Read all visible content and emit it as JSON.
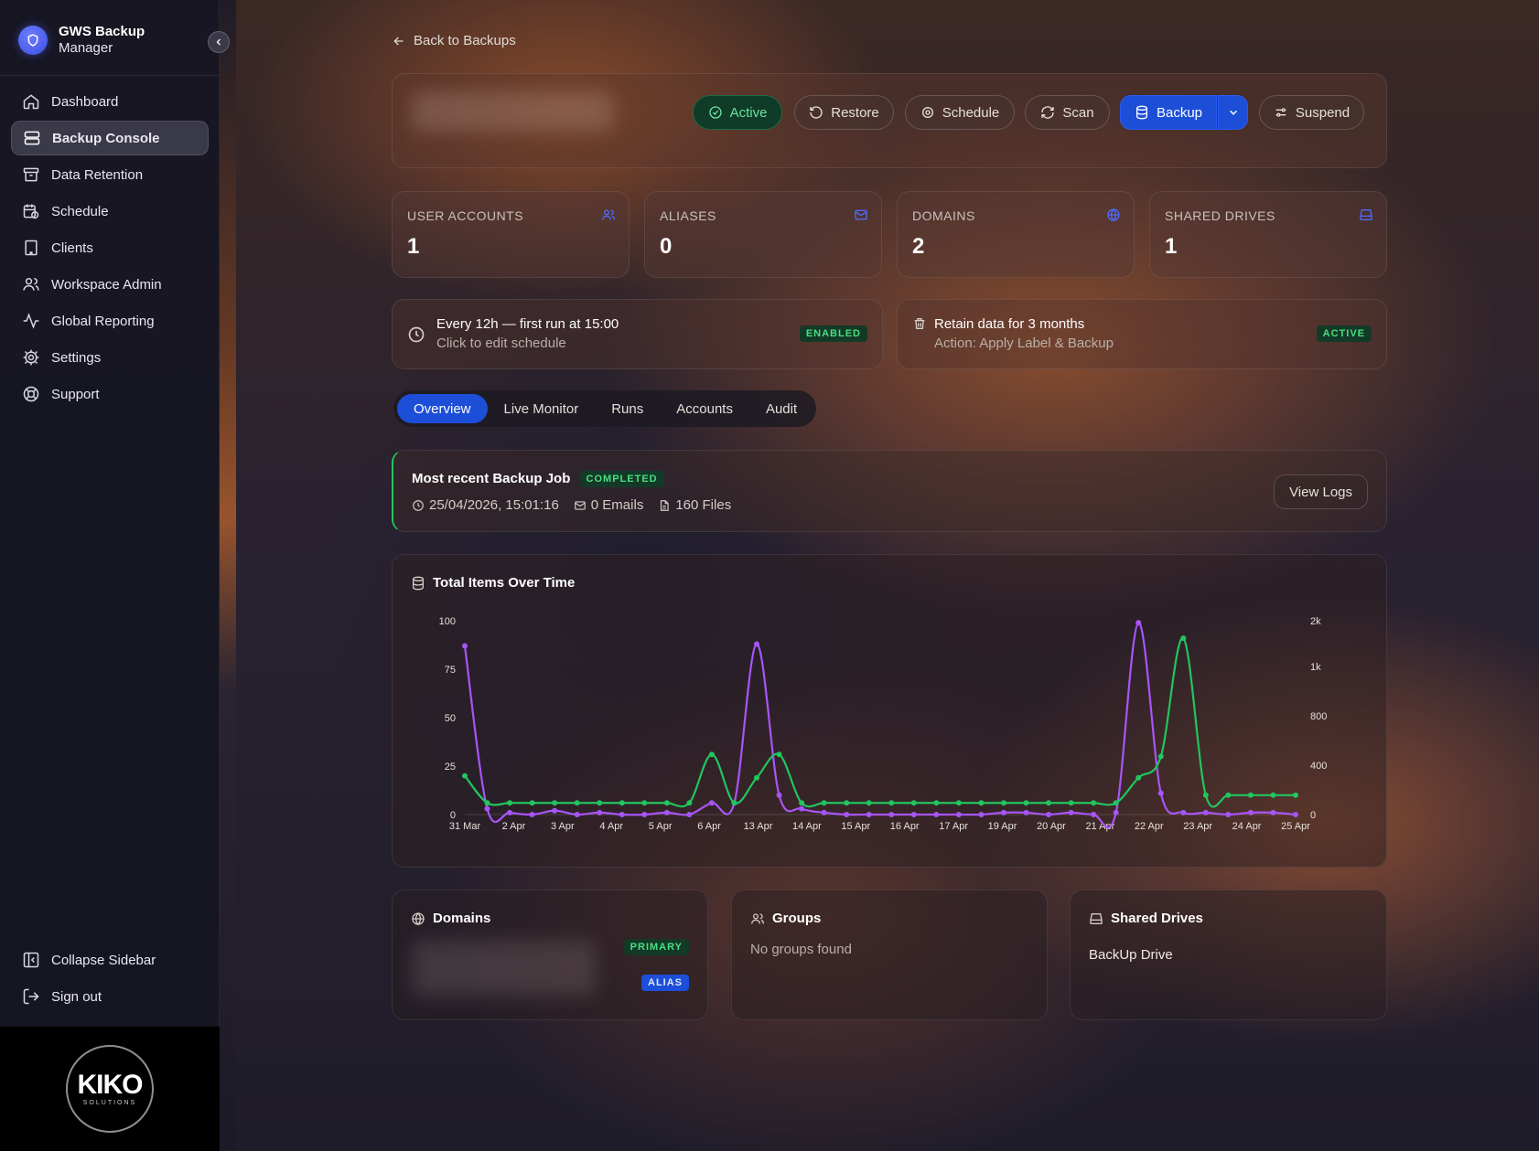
{
  "app": {
    "title_line1": "GWS Backup",
    "title_line2": "Manager"
  },
  "sidebar": {
    "items": [
      {
        "label": "Dashboard",
        "icon": "home-icon"
      },
      {
        "label": "Backup Console",
        "icon": "server-icon",
        "active": true
      },
      {
        "label": "Data Retention",
        "icon": "archive-icon"
      },
      {
        "label": "Schedule",
        "icon": "calendar-clock-icon"
      },
      {
        "label": "Clients",
        "icon": "building-icon"
      },
      {
        "label": "Workspace Admin",
        "icon": "users-icon"
      },
      {
        "label": "Global Reporting",
        "icon": "activity-icon"
      },
      {
        "label": "Settings",
        "icon": "gear-icon"
      },
      {
        "label": "Support",
        "icon": "lifebuoy-icon"
      }
    ],
    "bottom": [
      {
        "label": "Collapse Sidebar",
        "icon": "panel-collapse-icon"
      },
      {
        "label": "Sign out",
        "icon": "sign-out-icon"
      }
    ],
    "footer_logo": {
      "name": "KIKO",
      "sub": "SOLUTIONS"
    }
  },
  "header": {
    "back_label": "Back to Backups",
    "buttons": {
      "active": "Active",
      "restore": "Restore",
      "schedule": "Schedule",
      "scan": "Scan",
      "backup": "Backup",
      "suspend": "Suspend"
    }
  },
  "stats": [
    {
      "label": "USER ACCOUNTS",
      "value": "1",
      "icon": "users-icon"
    },
    {
      "label": "ALIASES",
      "value": "0",
      "icon": "mail-icon"
    },
    {
      "label": "DOMAINS",
      "value": "2",
      "icon": "globe-icon"
    },
    {
      "label": "SHARED DRIVES",
      "value": "1",
      "icon": "drive-icon"
    }
  ],
  "schedule_info": {
    "title": "Every 12h — first run at 15:00",
    "subtitle": "Click to edit schedule",
    "badge": "ENABLED"
  },
  "retention_info": {
    "title": "Retain data for 3 months",
    "subtitle": "Action: Apply Label & Backup",
    "badge": "ACTIVE"
  },
  "tabs": [
    "Overview",
    "Live Monitor",
    "Runs",
    "Accounts",
    "Audit"
  ],
  "job": {
    "title": "Most recent Backup Job",
    "status": "COMPLETED",
    "timestamp": "25/04/2026, 15:01:16",
    "emails": "0 Emails",
    "files": "160 Files",
    "view_logs": "View Logs"
  },
  "chart_data": {
    "type": "line",
    "title": "Total Items Over Time",
    "categories": [
      "31 Mar",
      "2 Apr",
      "3 Apr",
      "4 Apr",
      "5 Apr",
      "6 Apr",
      "13 Apr",
      "14 Apr",
      "15 Apr",
      "16 Apr",
      "17 Apr",
      "19 Apr",
      "20 Apr",
      "21 Apr",
      "22 Apr",
      "23 Apr",
      "24 Apr",
      "25 Apr"
    ],
    "y_left": {
      "ticks": [
        "0",
        "25",
        "50",
        "75",
        "100"
      ],
      "range": [
        0,
        100
      ]
    },
    "y_right": {
      "ticks": [
        "0",
        "400",
        "800",
        "1k",
        "2k"
      ]
    },
    "series": [
      {
        "color": "#a855f7",
        "axis": "left",
        "values": [
          87,
          3,
          1,
          0,
          2,
          0,
          1,
          0,
          0,
          1,
          0,
          6,
          6,
          88,
          10,
          3,
          1,
          0,
          0,
          0,
          0,
          0,
          0,
          0,
          1,
          1,
          0,
          1,
          0,
          1,
          99,
          11,
          1,
          1,
          0,
          1,
          1,
          0
        ]
      },
      {
        "color": "#22c55e",
        "axis": "right",
        "values": [
          20,
          6,
          6,
          6,
          6,
          6,
          6,
          6,
          6,
          6,
          6,
          31,
          6,
          19,
          31,
          6,
          6,
          6,
          6,
          6,
          6,
          6,
          6,
          6,
          6,
          6,
          6,
          6,
          6,
          6,
          19,
          30,
          91,
          10,
          10,
          10,
          10,
          10
        ]
      }
    ],
    "grid": false,
    "legend": "none"
  },
  "cards": {
    "domains": {
      "title": "Domains",
      "badge_primary": "PRIMARY",
      "badge_alias": "ALIAS"
    },
    "groups": {
      "title": "Groups",
      "empty": "No groups found"
    },
    "shared_drives": {
      "title": "Shared Drives",
      "item": "BackUp Drive"
    }
  },
  "colors": {
    "accent": "#1d4ed8",
    "success": "#22c55e",
    "purple": "#a855f7"
  }
}
